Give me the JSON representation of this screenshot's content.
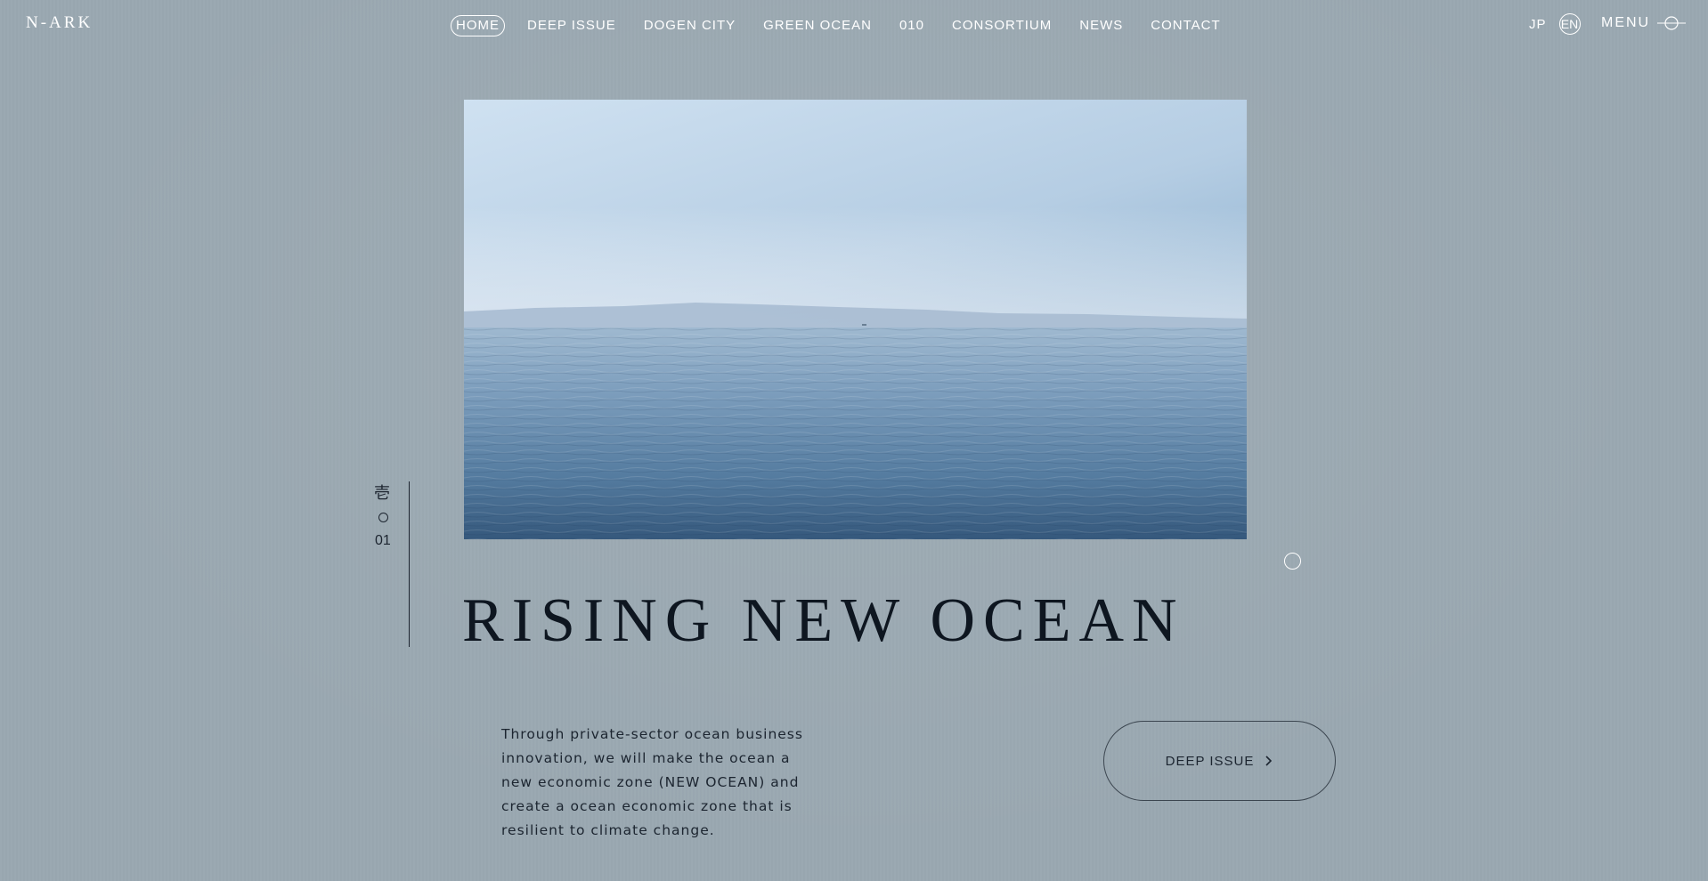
{
  "header": {
    "logo": "N-ARK",
    "nav": [
      {
        "label": "HOME",
        "active": true
      },
      {
        "label": "DEEP ISSUE"
      },
      {
        "label": "DOGEN CITY"
      },
      {
        "label": "GREEN OCEAN"
      },
      {
        "label": "010"
      },
      {
        "label": "CONSORTIUM"
      },
      {
        "label": "NEWS"
      },
      {
        "label": "CONTACT"
      }
    ],
    "lang_jp": "JP",
    "lang_en": "EN",
    "menu_label": "MENU",
    "menu_icon": "menu-circle-line-icon"
  },
  "indicator": {
    "kanji": "壱",
    "number": "01"
  },
  "hero": {
    "image": "ocean-horizon-photo",
    "title": "RISING NEW OCEAN",
    "description": "Through private-sector ocean business innovation, we will make the ocean a new economic zone (NEW OCEAN) and create a ocean economic zone that is resilient to climate change.",
    "cta_label": "DEEP ISSUE",
    "cta_icon": "chevron-right-icon"
  },
  "colors": {
    "background": "#9aa8b1",
    "title": "#0e1620",
    "text": "#1c2530",
    "nav": "#ffffff"
  }
}
